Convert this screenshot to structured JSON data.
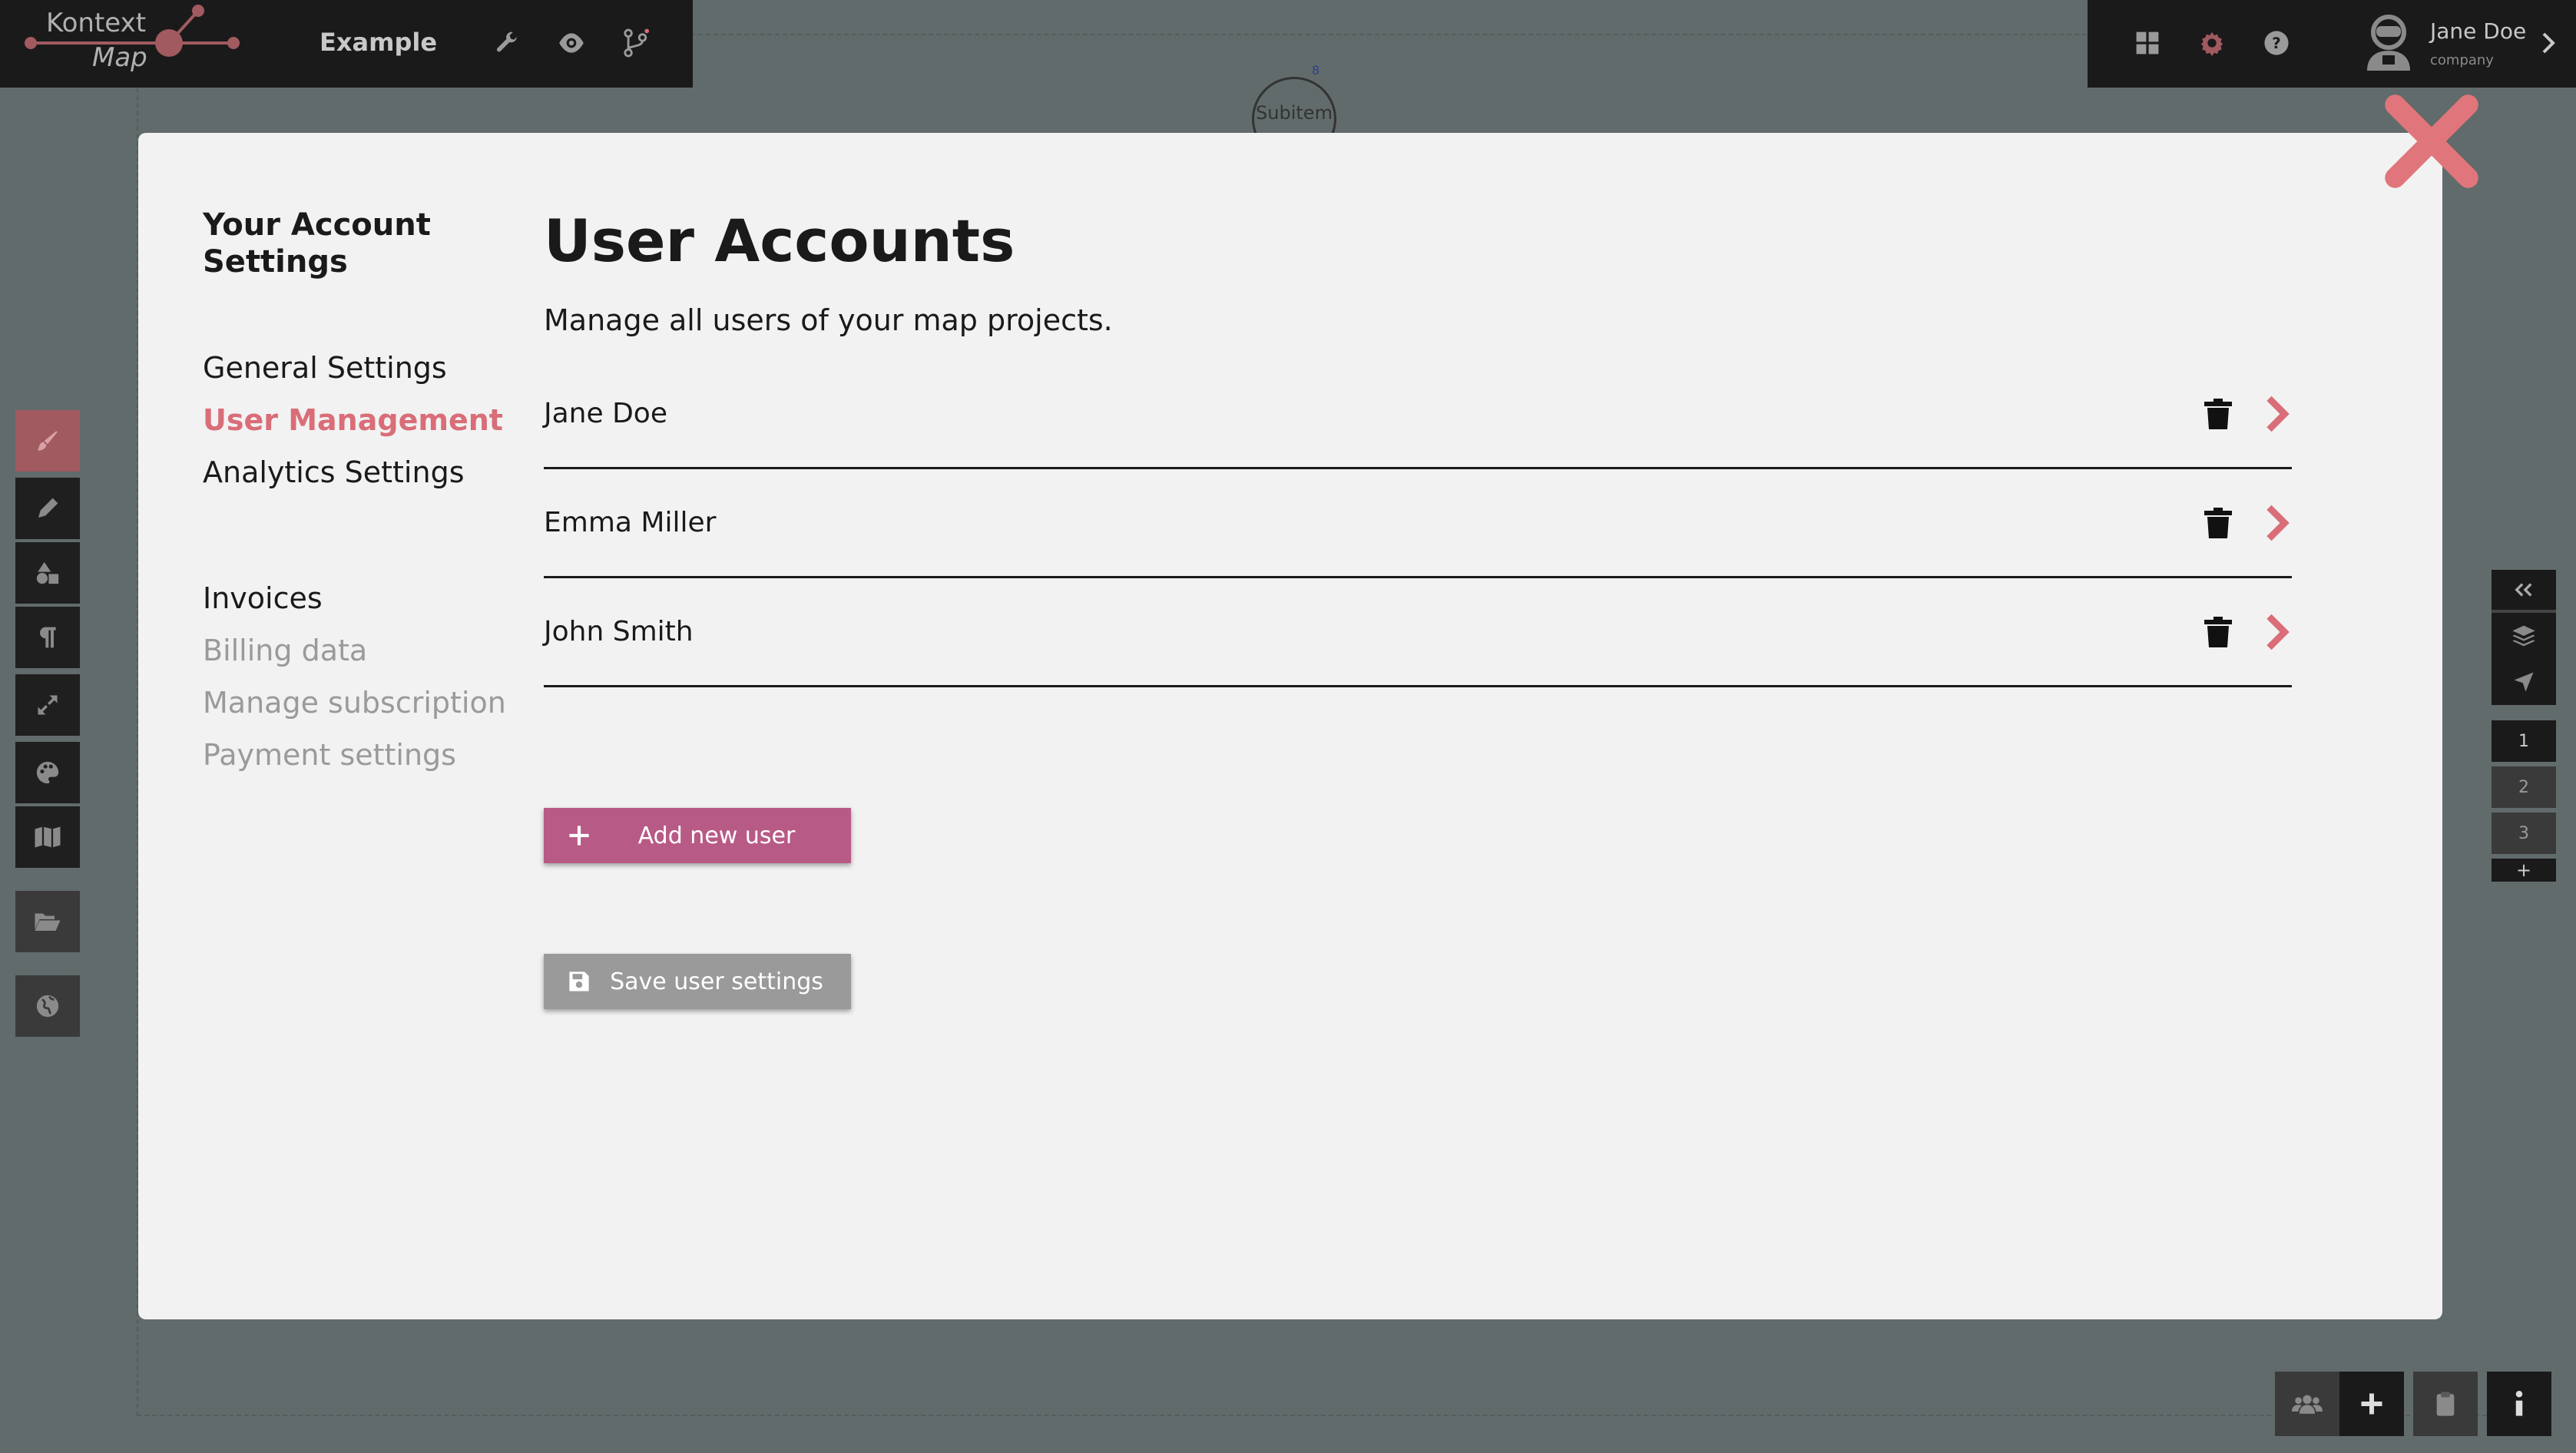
{
  "app": {
    "logo_line1": "Kontext",
    "logo_line2": "Map",
    "project_name": "Example"
  },
  "user_menu": {
    "name": "Jane Doe",
    "company": "company"
  },
  "canvas": {
    "node_label": "Subitem",
    "node_badge": "8"
  },
  "page_switcher": {
    "pages": [
      "1",
      "2",
      "3"
    ],
    "add_label": "+"
  },
  "modal": {
    "side_nav": {
      "heading": "Your Account Settings",
      "group1": [
        "General Settings",
        "User Management",
        "Analytics Settings"
      ],
      "group2_heading": "Invoices",
      "group2": [
        "Billing data",
        "Manage subscription",
        "Payment settings"
      ]
    },
    "title": "User Accounts",
    "subtitle": "Manage all users of your map projects.",
    "users": [
      "Jane Doe",
      "Emma Miller",
      "John Smith"
    ],
    "add_button": "Add new user",
    "save_button": "Save user settings"
  },
  "colors": {
    "accent": "#d96d78",
    "add_button": "#b85a86",
    "save_button": "#9a9a9a",
    "topbar": "#1a1a1a",
    "backdrop": "#626b6b"
  }
}
